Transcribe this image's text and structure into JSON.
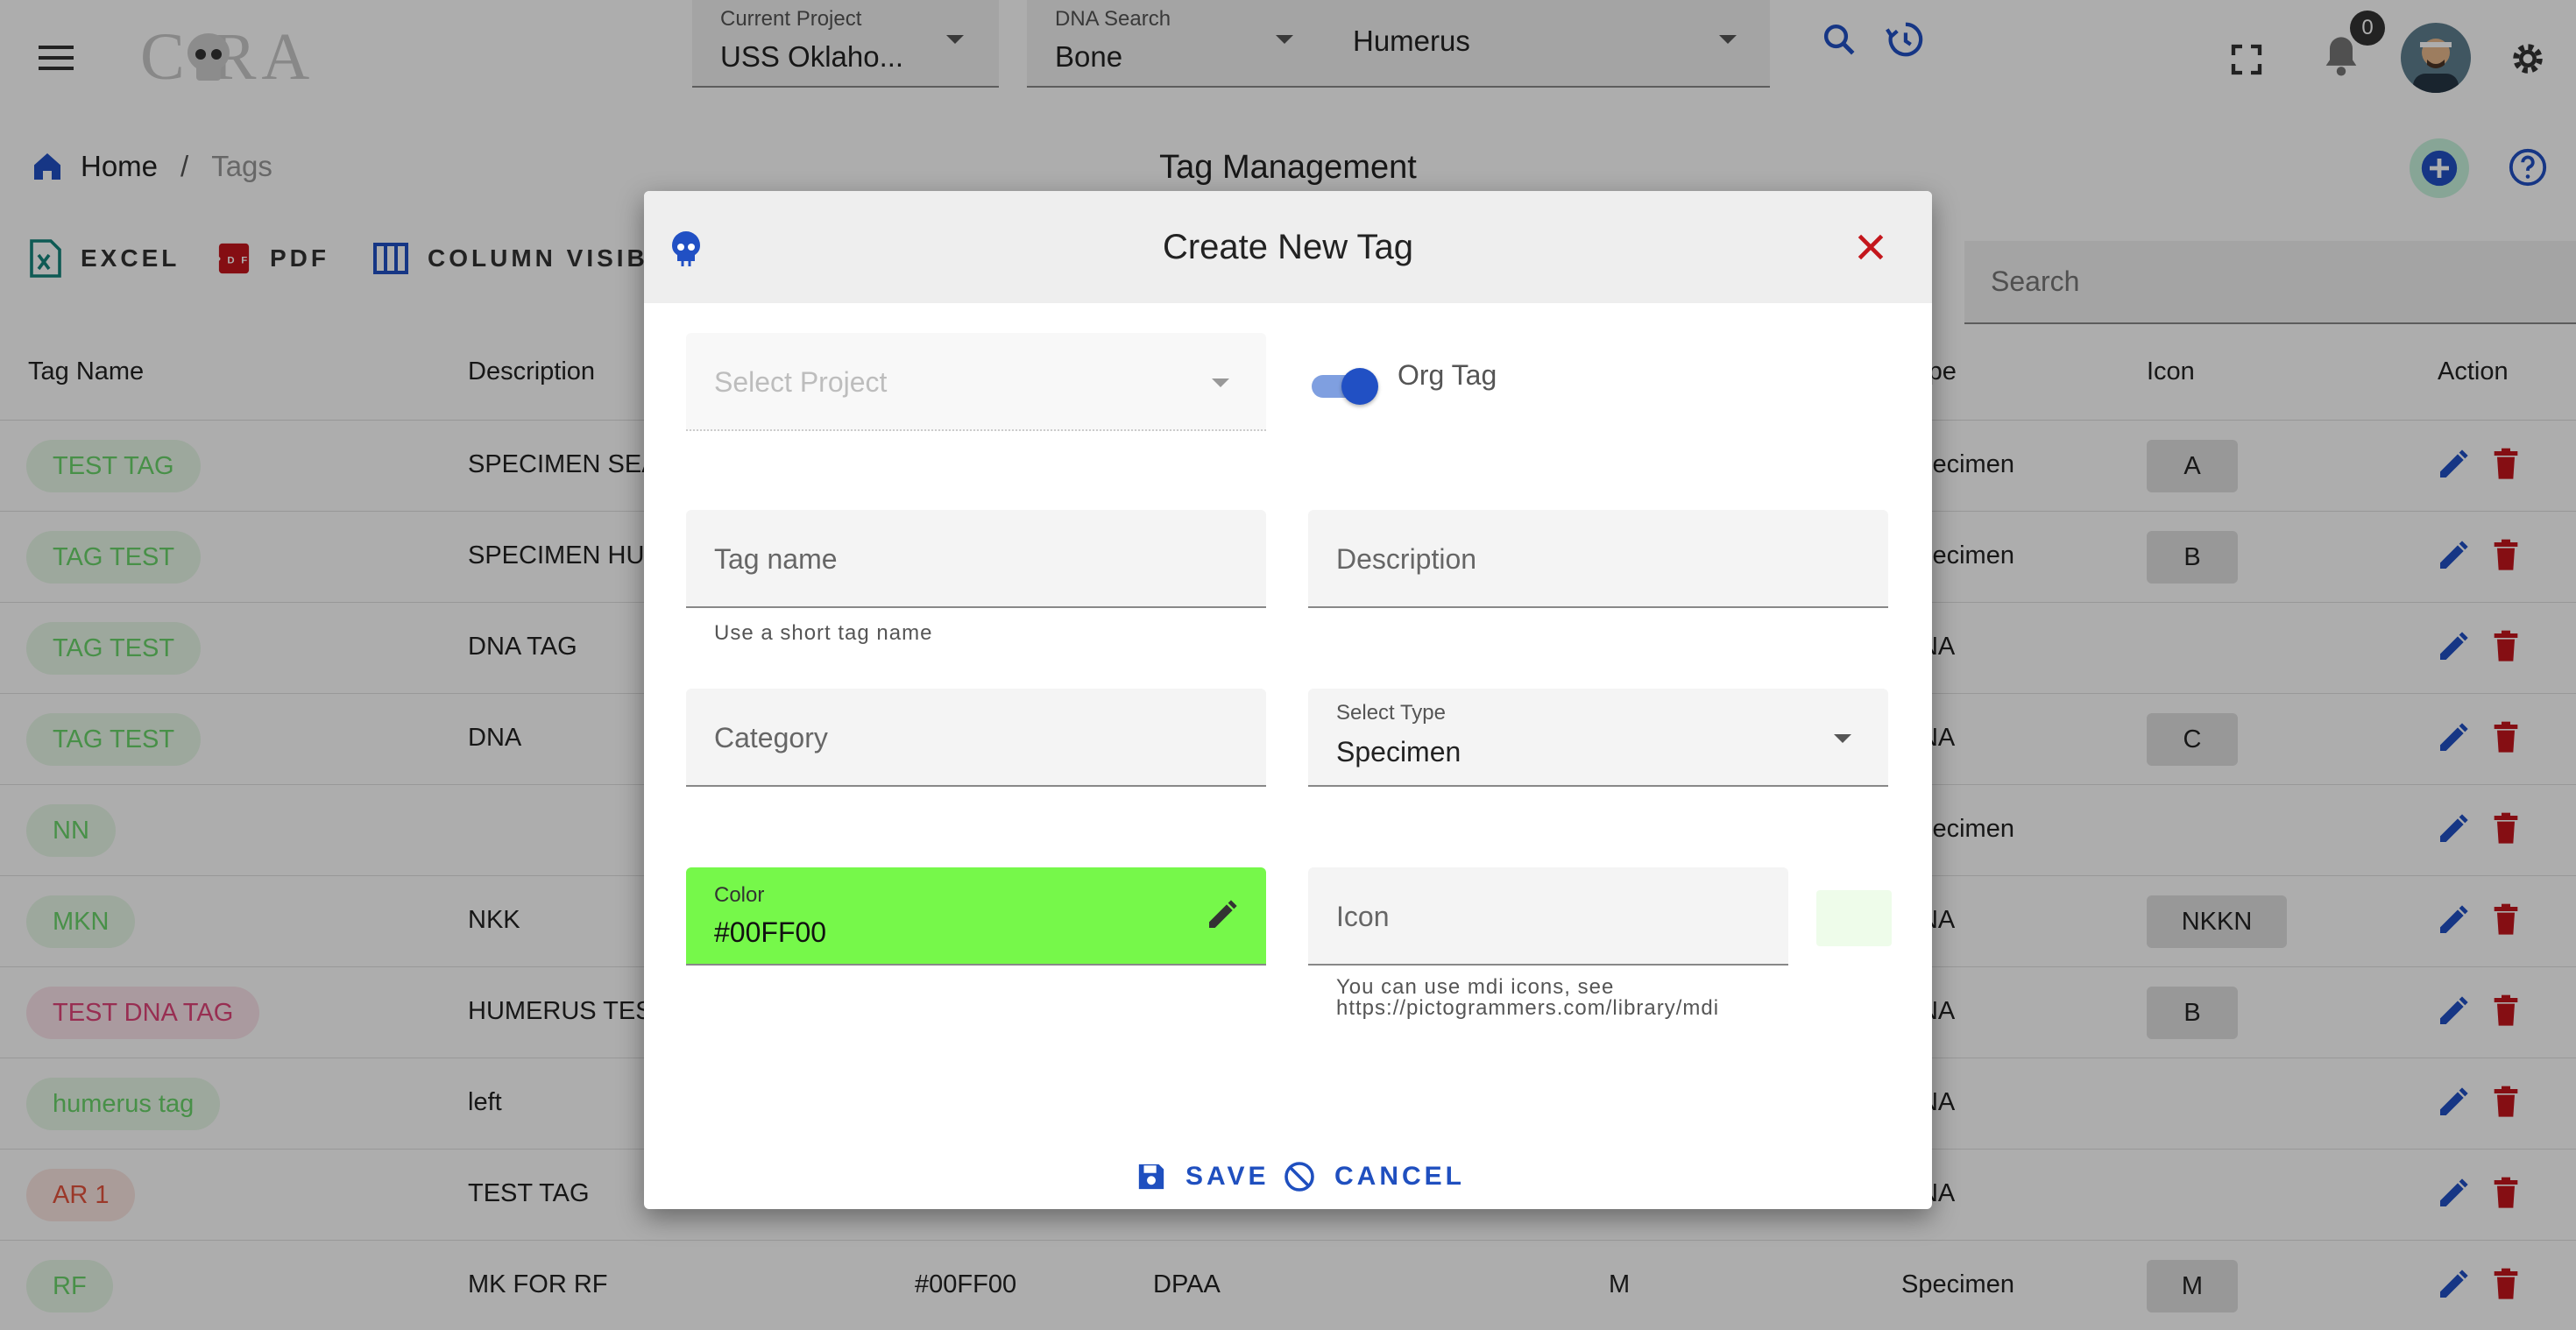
{
  "header": {
    "logo_text": "C RA",
    "current_project": {
      "label": "Current Project",
      "value": "USS Oklaho..."
    },
    "dna_search": {
      "label": "DNA Search",
      "value": "Bone"
    },
    "bone_select": {
      "value": "Humerus"
    },
    "notification_count": "0"
  },
  "breadcrumb": {
    "home": "Home",
    "separator": "/",
    "current": "Tags"
  },
  "page_title": "Tag Management",
  "toolbar": {
    "excel": "EXCEL",
    "pdf": "PDF",
    "columns": "COLUMN VISIBILITY",
    "search_placeholder": "Search"
  },
  "table": {
    "columns": [
      "Tag Name",
      "Description",
      "Type",
      "Icon",
      "Action"
    ],
    "rows": [
      {
        "tag": "TEST TAG",
        "tag_color": "#6bd46b",
        "chip_bg": "#e7f8e7",
        "description": "SPECIMEN SEARCH",
        "color": "",
        "category": "",
        "org": "",
        "type": "Specimen",
        "icon": "A"
      },
      {
        "tag": "TAG TEST",
        "tag_color": "#6bd46b",
        "chip_bg": "#e7f8e7",
        "description": "SPECIMEN HUMERUS",
        "color": "",
        "category": "",
        "org": "",
        "type": "Specimen",
        "icon": "B"
      },
      {
        "tag": "TAG TEST",
        "tag_color": "#6bd46b",
        "chip_bg": "#e7f8e7",
        "description": "DNA TAG",
        "color": "",
        "category": "",
        "org": "",
        "type": "DNA",
        "icon": ""
      },
      {
        "tag": "TAG TEST",
        "tag_color": "#6bd46b",
        "chip_bg": "#e7f8e7",
        "description": "DNA",
        "color": "",
        "category": "",
        "org": "",
        "type": "DNA",
        "icon": "C"
      },
      {
        "tag": "NN",
        "tag_color": "#6bd46b",
        "chip_bg": "#e7f8e7",
        "description": "",
        "color": "",
        "category": "",
        "org": "",
        "type": "Specimen",
        "icon": ""
      },
      {
        "tag": "MKN",
        "tag_color": "#6bd46b",
        "chip_bg": "#e7f8e7",
        "description": "NKK",
        "color": "",
        "category": "",
        "org": "",
        "type": "DNA",
        "icon": "NKKN"
      },
      {
        "tag": "TEST DNA TAG",
        "tag_color": "#e0457a",
        "chip_bg": "#fbe3ea",
        "description": "HUMERUS TEST",
        "color": "",
        "category": "",
        "org": "",
        "type": "DNA",
        "icon": "B"
      },
      {
        "tag": "humerus tag",
        "tag_color": "#6bd46b",
        "chip_bg": "#e7f8e7",
        "description": "left",
        "color": "",
        "category": "",
        "org": "",
        "type": "DNA",
        "icon": ""
      },
      {
        "tag": "AR 1",
        "tag_color": "#e5533d",
        "chip_bg": "#fbe6e2",
        "description": "TEST TAG",
        "color": "",
        "category": "",
        "org": "",
        "type": "DNA",
        "icon": ""
      },
      {
        "tag": "RF",
        "tag_color": "#6bd46b",
        "chip_bg": "#e7f8e7",
        "description": "MK FOR RF",
        "color": "#00FF00",
        "category": "DPAA",
        "org": "M",
        "type": "Specimen",
        "icon": "M"
      }
    ]
  },
  "dialog": {
    "title": "Create New Tag",
    "select_project_placeholder": "Select Project",
    "org_tag_label": "Org Tag",
    "org_tag_on": true,
    "tag_name_placeholder": "Tag name",
    "tag_name_hint": "Use a short tag name",
    "description_placeholder": "Description",
    "category_placeholder": "Category",
    "type_label": "Select Type",
    "type_value": "Specimen",
    "color_label": "Color",
    "color_value": "#00FF00",
    "color_swatch": "#76f84a",
    "icon_placeholder": "Icon",
    "icon_hint_line1": "You can use mdi icons, see",
    "icon_hint_line2": "https://pictogrammers.com/library/mdi",
    "save_label": "SAVE",
    "cancel_label": "CANCEL"
  },
  "colors": {
    "accent_blue": "#2150c4",
    "danger_red": "#c4161c",
    "teal": "#16857d"
  }
}
